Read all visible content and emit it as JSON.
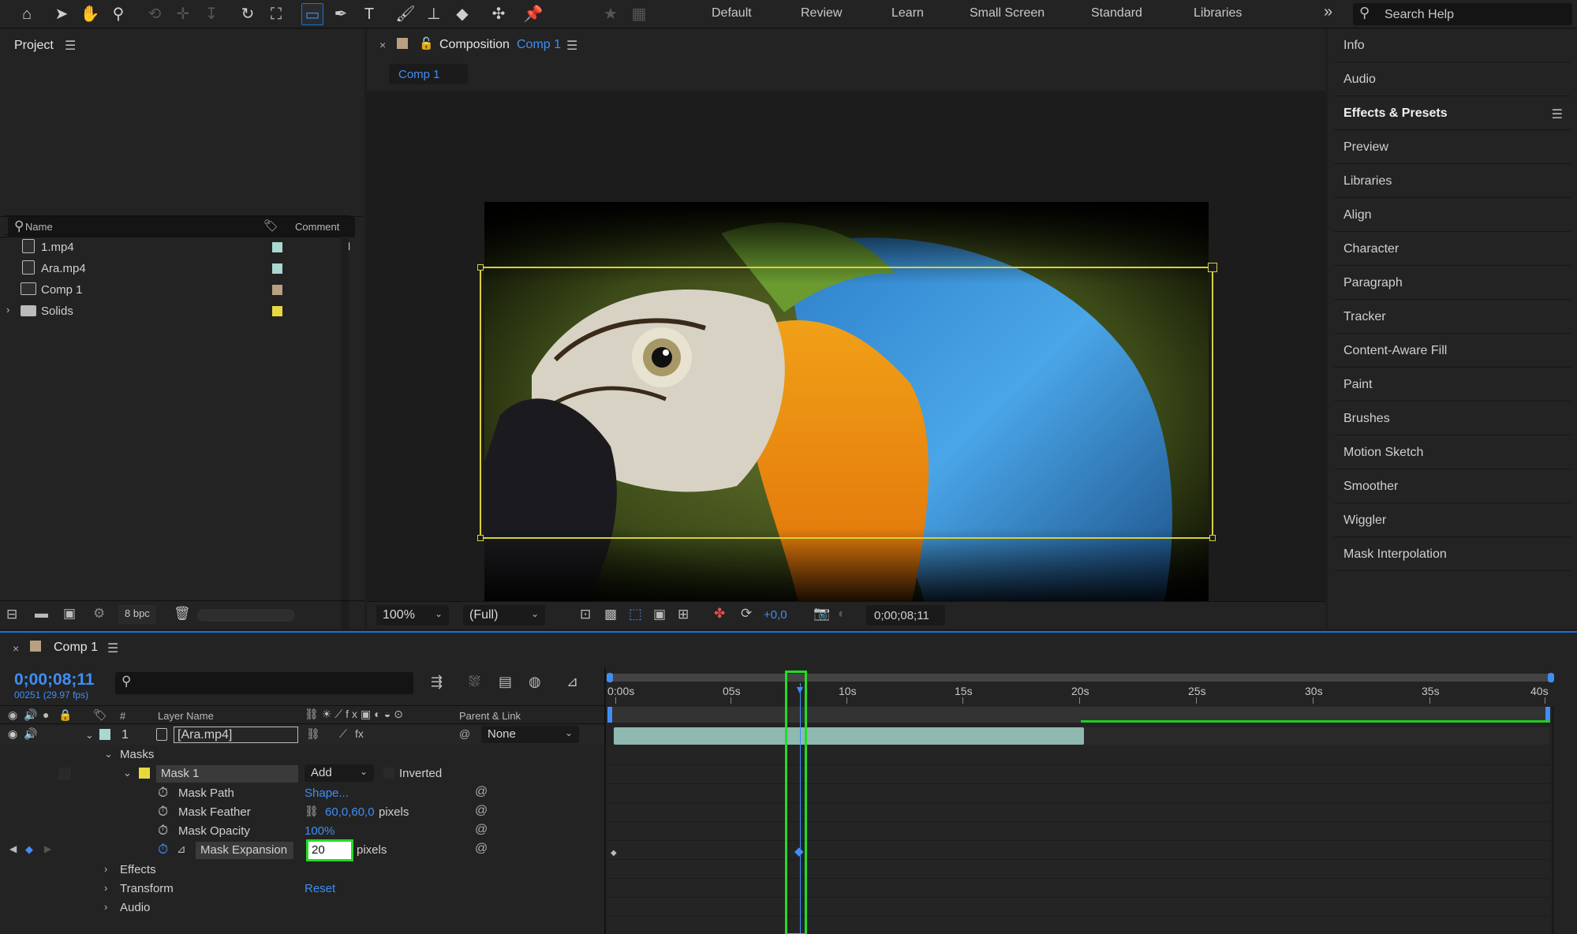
{
  "toolbar": {
    "workspaces": [
      "Default",
      "Review",
      "Learn",
      "Small Screen",
      "Standard",
      "Libraries"
    ],
    "overflow": "»",
    "search_label": "Search Help"
  },
  "project": {
    "title": "Project",
    "columns": {
      "name": "Name",
      "comment": "Comment"
    },
    "items": [
      {
        "name": "1.mp4",
        "color": "#a8d8d0"
      },
      {
        "name": "Ara.mp4",
        "color": "#a8d8d0"
      },
      {
        "name": "Comp 1",
        "color": "#b8a080"
      },
      {
        "name": "Solids",
        "color": "#e8d840"
      }
    ],
    "bpc": "8 bpc"
  },
  "composition": {
    "tab_title": "Composition",
    "tab_comp": "Comp 1",
    "subtab": "Comp 1",
    "zoom": "100%",
    "resolution": "(Full)",
    "exposure": "+0,0",
    "timecode": "0;00;08;11"
  },
  "right_panel": {
    "items": [
      "Info",
      "Audio",
      "Effects & Presets",
      "Preview",
      "Libraries",
      "Align",
      "Character",
      "Paragraph",
      "Tracker",
      "Content-Aware Fill",
      "Paint",
      "Brushes",
      "Motion Sketch",
      "Smoother",
      "Wiggler",
      "Mask Interpolation"
    ]
  },
  "timeline": {
    "comp_name": "Comp 1",
    "current_time": "0;00;08;11",
    "frames": "00251 (29.97 fps)",
    "headers": {
      "num": "#",
      "layer_name": "Layer Name",
      "parent": "Parent & Link"
    },
    "layer": {
      "index": "1",
      "name": "[Ara.mp4]",
      "parent": "None"
    },
    "masks_label": "Masks",
    "mask": {
      "name": "Mask 1",
      "mode": "Add",
      "inverted": "Inverted"
    },
    "props": [
      {
        "name": "Mask Path",
        "value": "Shape..."
      },
      {
        "name": "Mask Feather",
        "value": "60,0,60,0",
        "unit": "pixels"
      },
      {
        "name": "Mask Opacity",
        "value": "100%"
      },
      {
        "name": "Mask Expansion",
        "value": "20",
        "unit": "pixels"
      }
    ],
    "groups": {
      "effects": "Effects",
      "transform": "Transform",
      "reset": "Reset",
      "audio": "Audio"
    },
    "ruler": [
      "0:00s",
      "05s",
      "10s",
      "15s",
      "20s",
      "25s",
      "30s",
      "35s",
      "40s"
    ],
    "highlight_color": "#22dd22",
    "accent_color": "#1473e6"
  }
}
